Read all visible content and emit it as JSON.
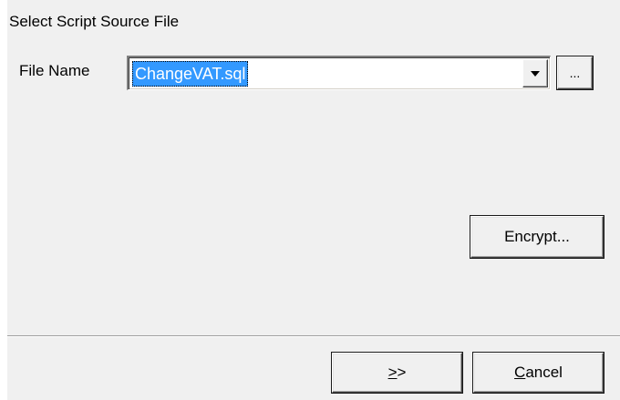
{
  "dialog": {
    "title": "Select Script Source File"
  },
  "file_name": {
    "label": "File Name",
    "value": "ChangeVAT.sql"
  },
  "buttons": {
    "browse_label": "...",
    "encrypt_label": "Encrypt...",
    "next_label_mnemonic": ">",
    "next_label_rest": ">",
    "cancel_label_mnemonic": "C",
    "cancel_label_rest": "ancel"
  },
  "icons": {
    "dropdown": "chevron-down-icon"
  }
}
